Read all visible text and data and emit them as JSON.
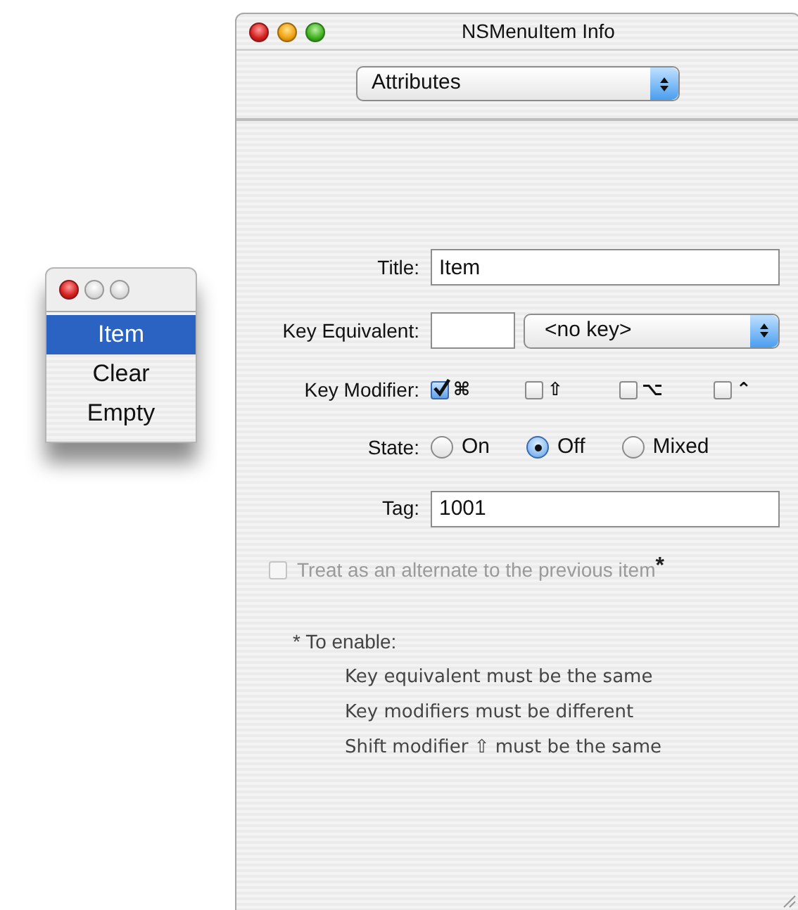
{
  "menu_window": {
    "items": [
      {
        "label": "Item",
        "selected": true
      },
      {
        "label": "Clear",
        "selected": false
      },
      {
        "label": "Empty",
        "selected": false
      }
    ]
  },
  "inspector": {
    "title": "NSMenuItem Info",
    "pane_popup": "Attributes",
    "title_field": {
      "label": "Title:",
      "value": "Item"
    },
    "key_equivalent": {
      "label": "Key Equivalent:",
      "popup": "<no key>"
    },
    "key_modifier": {
      "label": "Key Modifier:",
      "options": [
        {
          "symbol": "⌘",
          "checked": true
        },
        {
          "symbol": "⇧",
          "checked": false
        },
        {
          "symbol": "⌥",
          "checked": false
        },
        {
          "symbol": "⌃",
          "checked": false
        }
      ]
    },
    "state": {
      "label": "State:",
      "options": [
        {
          "label": "On",
          "selected": false
        },
        {
          "label": "Off",
          "selected": true
        },
        {
          "label": "Mixed",
          "selected": false
        }
      ]
    },
    "tag": {
      "label": "Tag:",
      "value": "1001"
    },
    "alternate": {
      "label": "Treat as an alternate to the previous item",
      "mark": "*",
      "checked": false,
      "disabled": true
    },
    "note": {
      "title": "* To enable:",
      "lines": [
        "Key equivalent must be the same",
        "Key modifiers must be different",
        "Shift modifier ⇧ must be the same"
      ]
    }
  }
}
